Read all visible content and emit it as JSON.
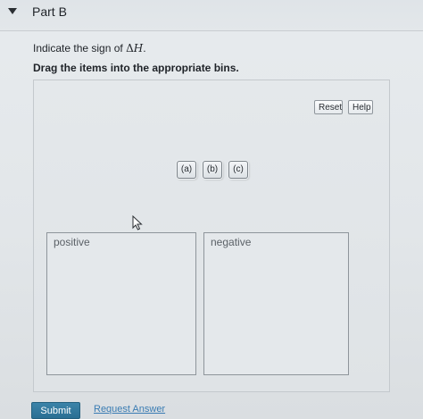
{
  "part": {
    "title": "Part B"
  },
  "question": {
    "prompt_text": "Indicate the sign of ",
    "delta_symbol": "Δ",
    "variable": "H",
    "prompt_end": ".",
    "instruction": "Drag the items into the appropriate bins."
  },
  "toolbar": {
    "reset_label": "Reset",
    "help_label": "Help"
  },
  "items": [
    {
      "label": "(a)"
    },
    {
      "label": "(b)"
    },
    {
      "label": "(c)"
    }
  ],
  "bins": [
    {
      "label": "positive"
    },
    {
      "label": "negative"
    }
  ],
  "actions": {
    "submit_label": "Submit",
    "request_answer_label": "Request Answer"
  },
  "colors": {
    "submit_bg": "#2f7499",
    "link": "#3a7cb3"
  }
}
